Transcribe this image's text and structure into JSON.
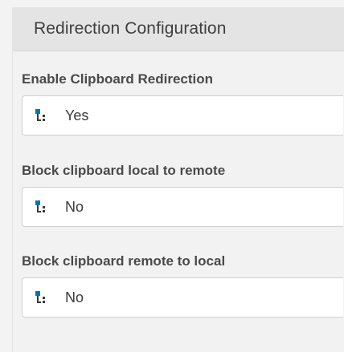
{
  "panel": {
    "title": "Redirection Configuration"
  },
  "fields": [
    {
      "label": "Enable Clipboard Redirection",
      "value": "Yes",
      "icon": "hierarchy-icon"
    },
    {
      "label": "Block clipboard local to remote",
      "value": "No",
      "icon": "hierarchy-icon"
    },
    {
      "label": "Block clipboard remote to local",
      "value": "No",
      "icon": "hierarchy-icon"
    }
  ],
  "colors": {
    "icon_accent": "#0078a8",
    "icon_dark": "#3c3c3c"
  }
}
